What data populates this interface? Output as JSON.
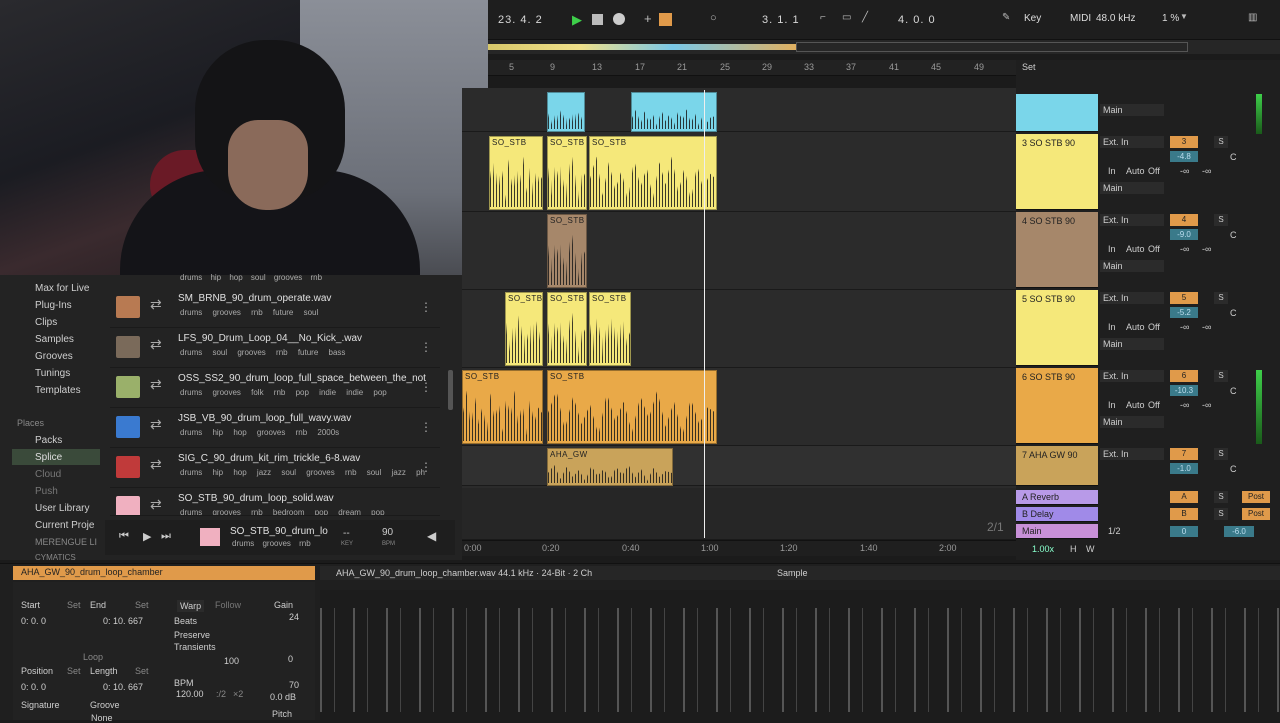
{
  "transport": {
    "position": "23.  4.  2",
    "loop_start": "3.  1.  1",
    "loop_length": "4.  0.  0",
    "key_label": "Key",
    "midi_label": "MIDI",
    "sample_rate": "48.0 kHz",
    "cpu": "1 %"
  },
  "ruler": {
    "bars": [
      "5",
      "9",
      "13",
      "17",
      "21",
      "25",
      "29",
      "33",
      "37",
      "41",
      "45",
      "49"
    ],
    "set_label": "Set"
  },
  "timeline": [
    "0:00",
    "0:20",
    "0:40",
    "1:00",
    "1:20",
    "1:40",
    "2:00"
  ],
  "page_indicator": "2/1",
  "tracks": [
    {
      "num": "3",
      "name": "3 SO STB 90",
      "color": "#f5e87a",
      "input": "Ext. In",
      "out": "Main",
      "vol": "-4.8",
      "pan": "C",
      "db1": "-∞",
      "db2": "-∞"
    },
    {
      "num": "4",
      "name": "4 SO STB 90",
      "color": "#a6876a",
      "input": "Ext. In",
      "out": "Main",
      "vol": "-9.0",
      "pan": "C",
      "db1": "-∞",
      "db2": "-∞"
    },
    {
      "num": "5",
      "name": "5 SO STB 90",
      "color": "#f5e87a",
      "input": "Ext. In",
      "out": "Main",
      "vol": "-5.2",
      "pan": "C",
      "db1": "-∞",
      "db2": "-∞"
    },
    {
      "num": "6",
      "name": "6 SO STB 90",
      "color": "#e9a948",
      "input": "Ext. In",
      "out": "Main",
      "vol": "-10.3",
      "pan": "C",
      "db1": "-∞",
      "db2": "-∞"
    },
    {
      "num": "7",
      "name": "7 AHA GW 90",
      "color": "#c9a35a",
      "input": "Ext. In",
      "out": "",
      "vol": "-1.0",
      "pan": "C",
      "db1": "",
      "": ""
    }
  ],
  "returns": [
    {
      "label": "A Reverb",
      "letter": "A",
      "post": "Post"
    },
    {
      "label": "B Delay",
      "letter": "B",
      "post": "Post"
    }
  ],
  "main_track": {
    "label": "Main",
    "ratio": "1/2",
    "vol": "0",
    "vol2": "-6.0"
  },
  "io_labels": {
    "in": "In",
    "auto": "Auto",
    "off": "Off",
    "s": "S",
    "main": "Main",
    "tempo": "1.00x",
    "h": "H",
    "w": "W"
  },
  "clip_labels": {
    "so": "SO_STB",
    "aha": "AHA_GW"
  },
  "browser": {
    "places_header": "Places",
    "categories": [
      "Max for Live",
      "Plug-Ins",
      "Clips",
      "Samples",
      "Grooves",
      "Tunings",
      "Templates"
    ],
    "places": [
      "Packs",
      "Splice",
      "Cloud",
      "Push",
      "User Library",
      "Current Proje",
      "MERENGUE LI",
      "CYMATICS"
    ],
    "top_tags": "drums  hip hop  soul  grooves  rnb",
    "items": [
      {
        "file": "SM_BRNB_90_drum_operate.wav",
        "tags": "drums grooves rnb future soul",
        "thumb": "#b87a52"
      },
      {
        "file": "LFS_90_Drum_Loop_04__No_Kick_.wav",
        "tags": "drums soul grooves rnb future bass",
        "thumb": "#7a6a5a"
      },
      {
        "file": "OSS_SS2_90_drum_loop_full_space_between_the_not",
        "tags": "drums grooves folk rnb pop indie indie pop",
        "thumb": "#9ab06a"
      },
      {
        "file": "JSB_VB_90_drum_loop_full_wavy.wav",
        "tags": "drums hip hop grooves rnb 2000s",
        "thumb": "#3a7ad0"
      },
      {
        "file": "SIG_C_90_drum_kit_rim_trickle_6-8.wav",
        "tags": "drums hip hop jazz soul grooves rnb soul jazz ph",
        "thumb": "#c03a3a"
      },
      {
        "file": "SO_STB_90_drum_loop_solid.wav",
        "tags": "drums grooves rnb bedroom pop dream pop",
        "thumb": "#f0b0c0"
      }
    ],
    "preview": {
      "file": "SO_STB_90_drum_lo",
      "tags": "drums grooves rnb",
      "key": "--",
      "key_lbl": "KEY",
      "bpm": "90",
      "bpm_lbl": "BPM"
    }
  },
  "clipview": {
    "title": "AHA_GW_90_drum_loop_chamber",
    "start_label": "Start",
    "end_label": "End",
    "set": "Set",
    "start": "0:  0.  0",
    "end": "0: 10. 667",
    "loop_label": "Loop",
    "position_label": "Position",
    "length_label": "Length",
    "position": "0:  0.  0",
    "length": "0: 10. 667",
    "signature_label": "Signature",
    "groove_label": "Groove",
    "groove_value": "None",
    "warp": "Warp",
    "follow": "Follow",
    "beats": "Beats",
    "preserve": "Preserve",
    "transients": "Transients",
    "trans_value": "100",
    "bpm_label": "BPM",
    "bpm": "120.00",
    "half": ":/2",
    "dbl": "×2",
    "gain_label": "Gain",
    "gain_db": "0.0 dB",
    "gain_hi": "24",
    "gain_zero": "0",
    "gain_lo": "70",
    "pitch": "Pitch",
    "sample_info": "AHA_GW_90_drum_loop_chamber.wav  44.1 kHz · 24-Bit · 2 Ch",
    "sample_tab": "Sample"
  }
}
